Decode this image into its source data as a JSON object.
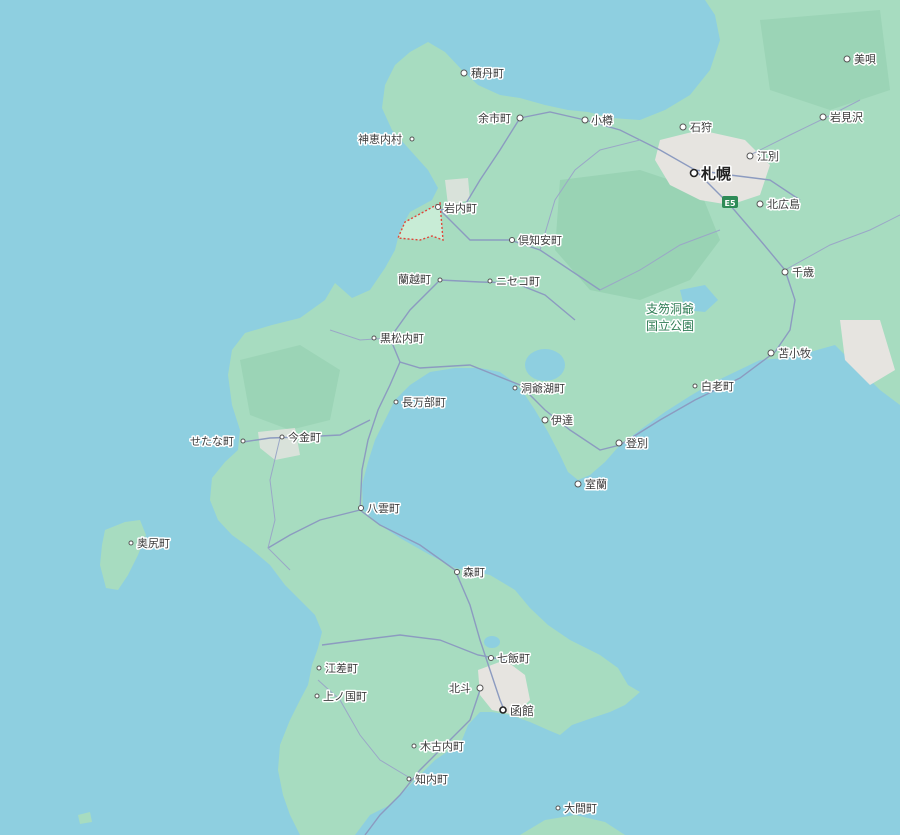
{
  "map": {
    "colors": {
      "water": "#8ecfe0",
      "land": "#a7dcc0",
      "land_dark": "#93cfaf",
      "urban": "#e6e4e0",
      "road": "#8c9bc0",
      "boundary": "#e0463a",
      "shield": "#2e8b57"
    },
    "highway_shield": "E5",
    "park_label": [
      "支笏洞爺",
      "国立公園"
    ],
    "places": {
      "bibai": "美唄",
      "shakotan": "積丹町",
      "yoichi": "余市町",
      "otaru": "小樽",
      "ishikari": "石狩",
      "iwamizawa": "岩見沢",
      "kamoenai": "神恵内村",
      "ebetsu": "江別",
      "sapporo": "札幌",
      "iwanai": "岩内町",
      "kitahiroshima": "北広島",
      "kutchan": "倶知安町",
      "rankoshi": "蘭越町",
      "niseko": "ニセコ町",
      "chitose": "千歳",
      "kuromatsunai": "黒松内町",
      "tomakomai": "苫小牧",
      "toyako": "洞爺湖町",
      "shiraoi": "白老町",
      "oshamambe": "長万部町",
      "date": "伊達",
      "setana": "せたな町",
      "imakane": "今金町",
      "noboribetsu": "登別",
      "muroran": "室蘭",
      "yakumo": "八雲町",
      "okushiri": "奥尻町",
      "mori": "森町",
      "nanae": "七飯町",
      "esashi": "江差町",
      "hokuto": "北斗",
      "kaminokuni": "上ノ国町",
      "hakodate": "函館",
      "kikonai": "木古内町",
      "shiriuchi": "知内町",
      "oma": "大間町"
    }
  }
}
